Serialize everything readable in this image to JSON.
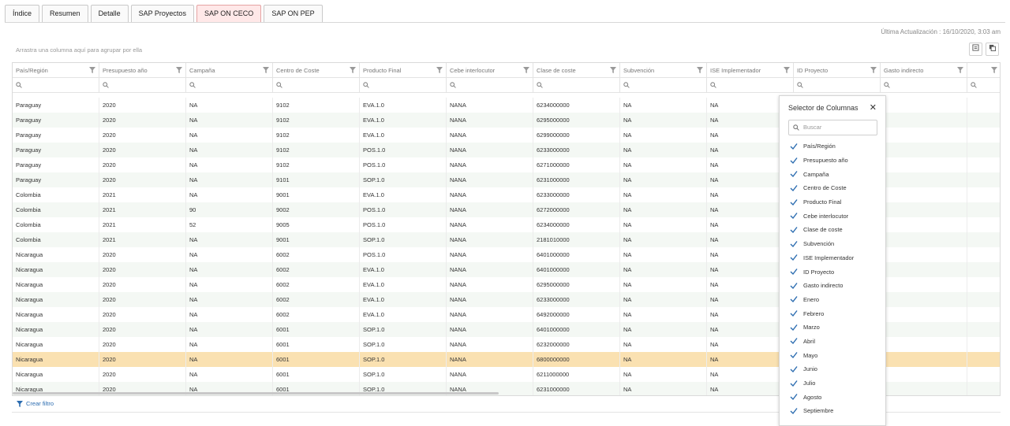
{
  "tabs": [
    "Índice",
    "Resumen",
    "Detalle",
    "SAP Proyectos",
    "SAP ON CECO",
    "SAP ON PEP"
  ],
  "active_tab": "SAP ON CECO",
  "last_update": "Última Actualización : 16/10/2020, 3:03 am",
  "group_hint": "Arrastra una columna aquí para agrupar por ella",
  "columns": [
    "País/Región",
    "Presupuesto año",
    "Campaña",
    "Centro de Coste",
    "Producto Final",
    "Cebe interlocutor",
    "Clase de coste",
    "Subvención",
    "ISE Implementador",
    "ID Proyecto",
    "Gasto indirecto",
    ""
  ],
  "rows": [
    [
      "Paraguay",
      "2020",
      "NA",
      "9102",
      "EVA.1.0",
      "NANA",
      "6234000000",
      "NA",
      "NA"
    ],
    [
      "Paraguay",
      "2020",
      "NA",
      "9102",
      "EVA.1.0",
      "NANA",
      "6295000000",
      "NA",
      "NA"
    ],
    [
      "Paraguay",
      "2020",
      "NA",
      "9102",
      "EVA.1.0",
      "NANA",
      "6299000000",
      "NA",
      "NA"
    ],
    [
      "Paraguay",
      "2020",
      "NA",
      "9102",
      "POS.1.0",
      "NANA",
      "6233000000",
      "NA",
      "NA"
    ],
    [
      "Paraguay",
      "2020",
      "NA",
      "9102",
      "POS.1.0",
      "NANA",
      "6271000000",
      "NA",
      "NA"
    ],
    [
      "Paraguay",
      "2020",
      "NA",
      "9101",
      "SOP.1.0",
      "NANA",
      "6231000000",
      "NA",
      "NA"
    ],
    [
      "Colombia",
      "2021",
      "NA",
      "9001",
      "EVA.1.0",
      "NANA",
      "6233000000",
      "NA",
      "NA"
    ],
    [
      "Colombia",
      "2021",
      "90",
      "9002",
      "POS.1.0",
      "NANA",
      "6272000000",
      "NA",
      "NA"
    ],
    [
      "Colombia",
      "2021",
      "52",
      "9005",
      "POS.1.0",
      "NANA",
      "6234000000",
      "NA",
      "NA"
    ],
    [
      "Colombia",
      "2021",
      "NA",
      "9001",
      "SOP.1.0",
      "NANA",
      "2181010000",
      "NA",
      "NA"
    ],
    [
      "Nicaragua",
      "2020",
      "NA",
      "6002",
      "POS.1.0",
      "NANA",
      "6401000000",
      "NA",
      "NA"
    ],
    [
      "Nicaragua",
      "2020",
      "NA",
      "6002",
      "EVA.1.0",
      "NANA",
      "6401000000",
      "NA",
      "NA"
    ],
    [
      "Nicaragua",
      "2020",
      "NA",
      "6002",
      "EVA.1.0",
      "NANA",
      "6295000000",
      "NA",
      "NA"
    ],
    [
      "Nicaragua",
      "2020",
      "NA",
      "6002",
      "EVA.1.0",
      "NANA",
      "6233000000",
      "NA",
      "NA"
    ],
    [
      "Nicaragua",
      "2020",
      "NA",
      "6002",
      "EVA.1.0",
      "NANA",
      "6492000000",
      "NA",
      "NA"
    ],
    [
      "Nicaragua",
      "2020",
      "NA",
      "6001",
      "SOP.1.0",
      "NANA",
      "6401000000",
      "NA",
      "NA"
    ],
    [
      "Nicaragua",
      "2020",
      "NA",
      "6001",
      "SOP.1.0",
      "NANA",
      "6232000000",
      "NA",
      "NA"
    ],
    [
      "Nicaragua",
      "2020",
      "NA",
      "6001",
      "SOP.1.0",
      "NANA",
      "6800000000",
      "NA",
      "NA"
    ],
    [
      "Nicaragua",
      "2020",
      "NA",
      "6001",
      "SOP.1.0",
      "NANA",
      "6211000000",
      "NA",
      "NA"
    ],
    [
      "Nicaragua",
      "2020",
      "NA",
      "6001",
      "SOP.1.0",
      "NANA",
      "6231000000",
      "NA",
      "NA"
    ]
  ],
  "selected_row": 17,
  "footer": {
    "create_filter": "Crear filtro"
  },
  "column_chooser": {
    "title": "Selector de Columnas",
    "search_placeholder": "Buscar",
    "items": [
      "País/Región",
      "Presupuesto año",
      "Campaña",
      "Centro de Coste",
      "Producto Final",
      "Cebe interlocutor",
      "Clase de coste",
      "Subvención",
      "ISE Implementador",
      "ID Proyecto",
      "Gasto indirecto",
      "Enero",
      "Febrero",
      "Marzo",
      "Abril",
      "Mayo",
      "Junio",
      "Julio",
      "Agosto",
      "Septiembre"
    ]
  },
  "icons": {
    "filter": "funnel-icon",
    "search": "search-icon",
    "check": "check-icon",
    "close": "close-icon",
    "export": "export-icon",
    "copy": "copy-icon"
  },
  "colors": {
    "active_tab_bg": "#ffe8e8",
    "selected_row": "#fae1b1",
    "alt_row": "#f4f8f4",
    "check": "#2b6cb0"
  }
}
